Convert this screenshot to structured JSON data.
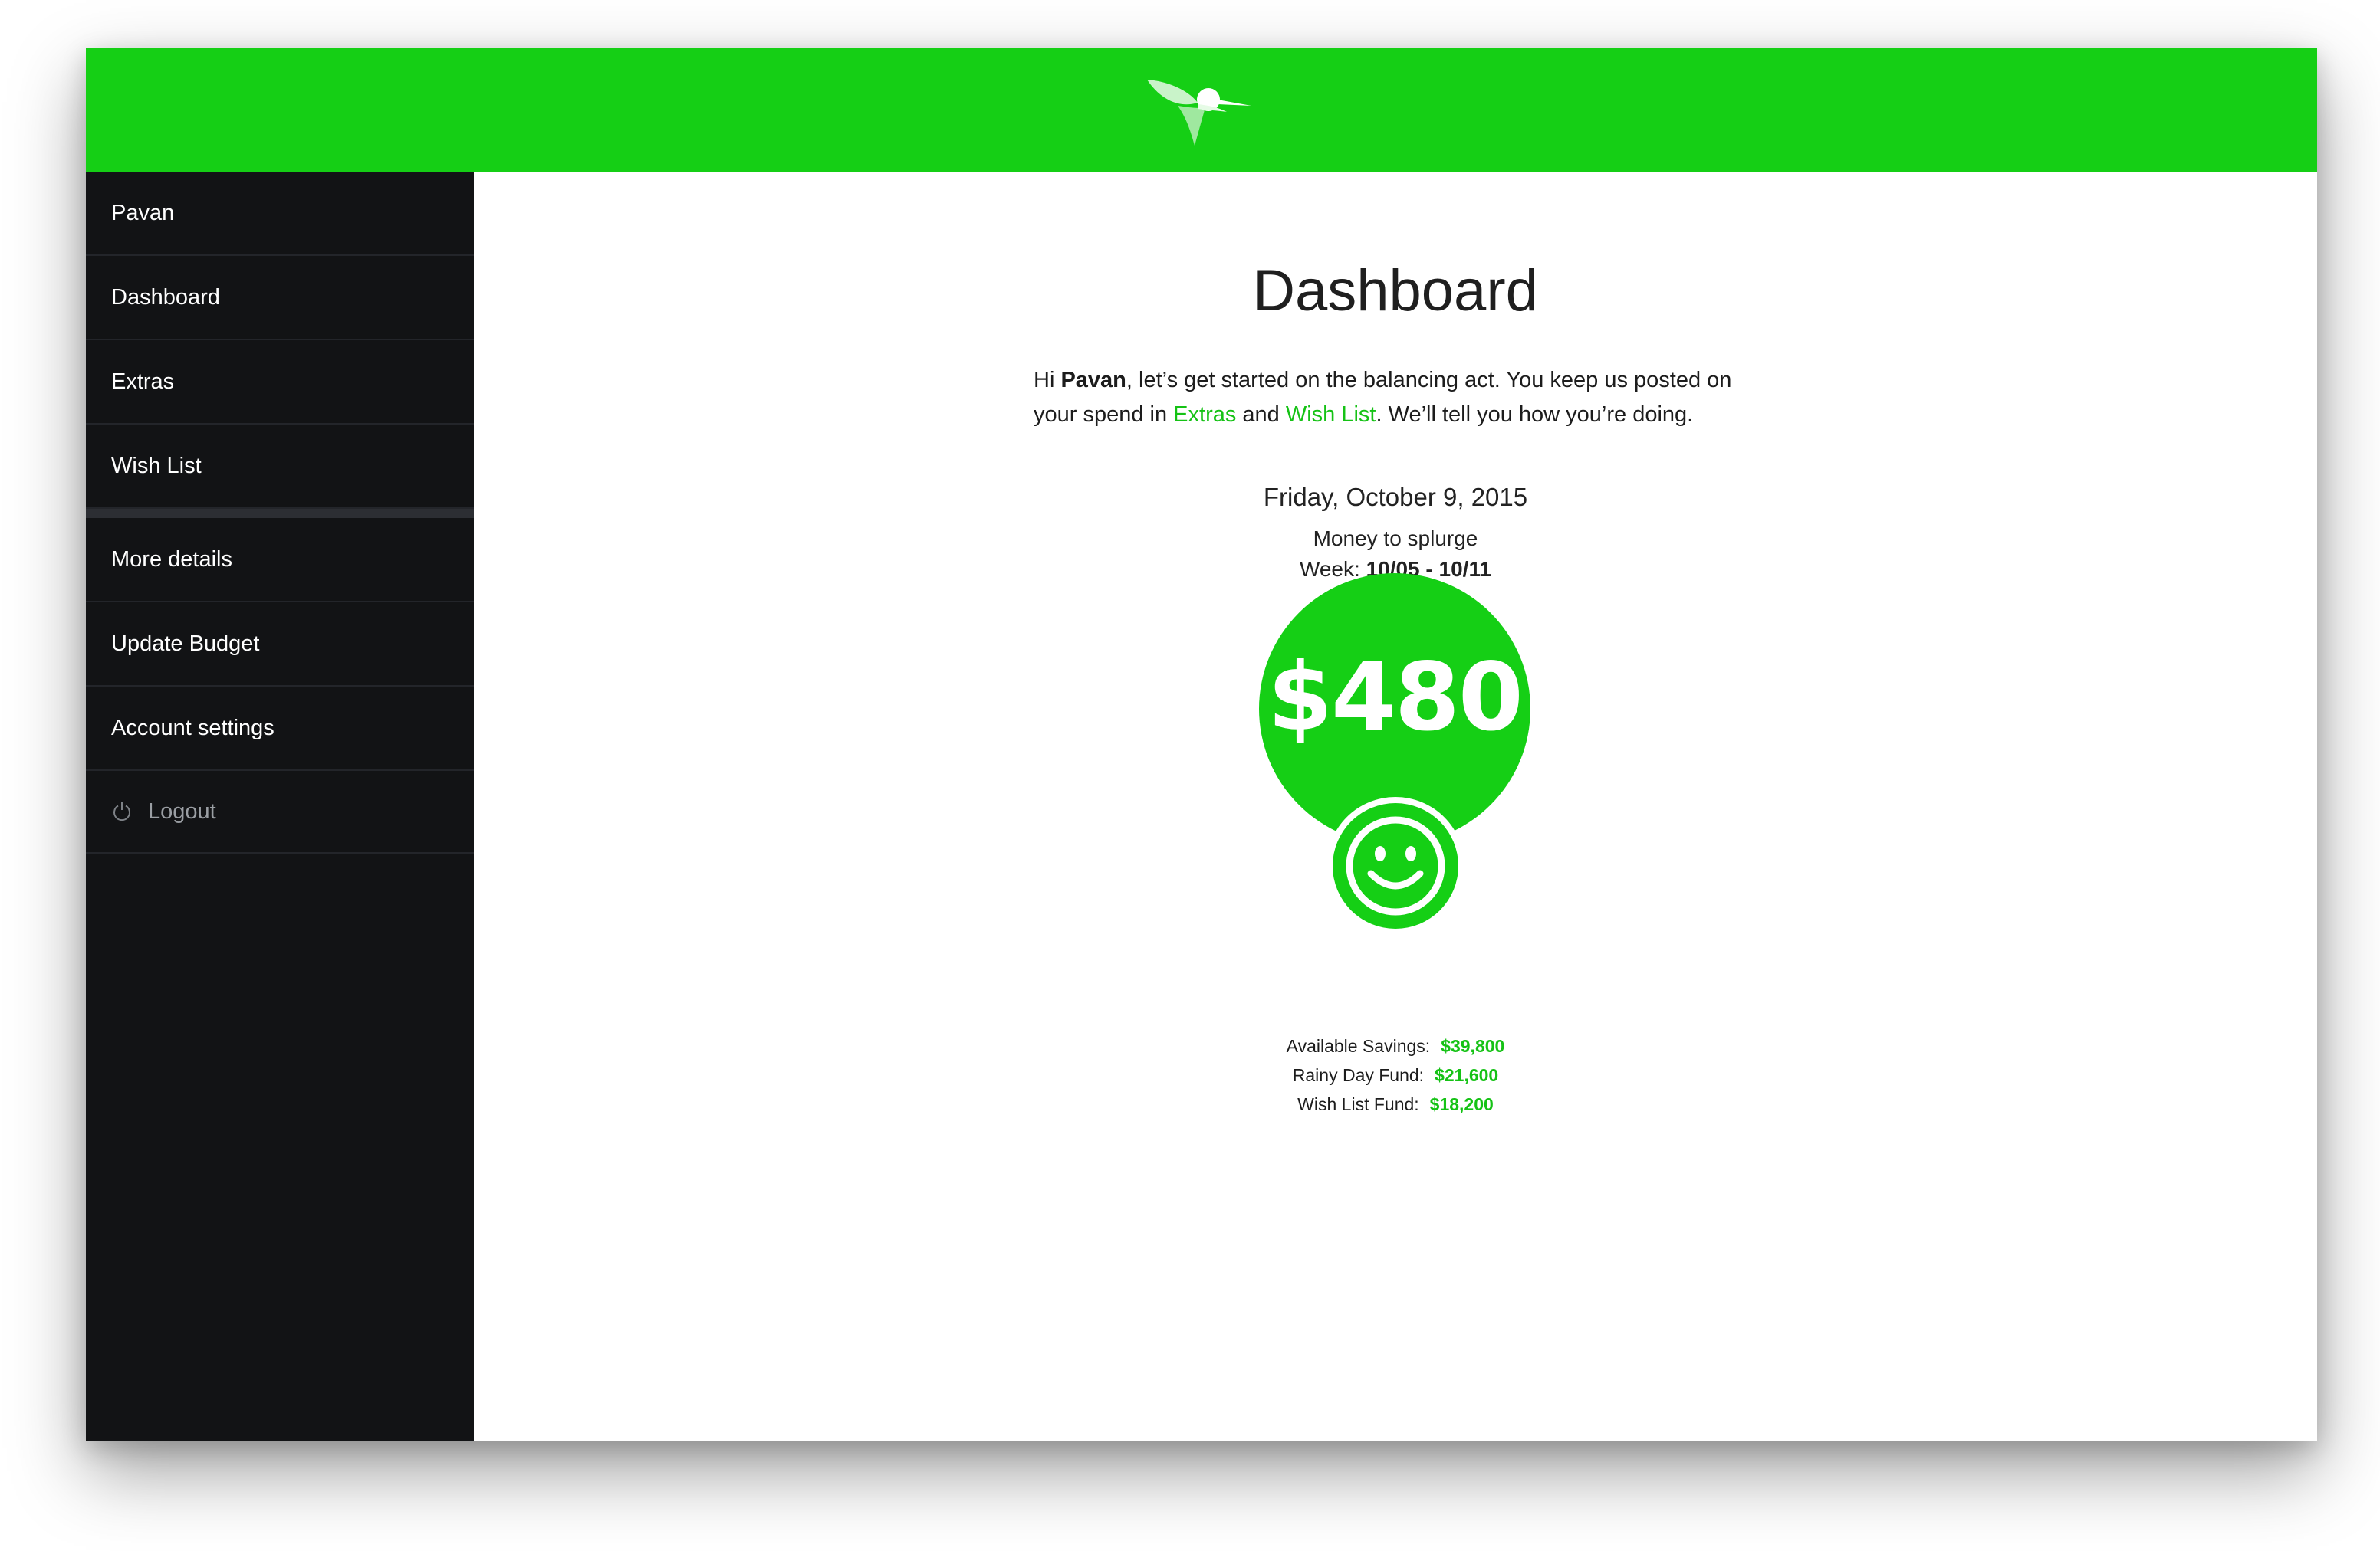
{
  "brand": {
    "accent_color": "#15cf15",
    "logo_icon": "hummingbird-logo-icon"
  },
  "sidebar": {
    "items": [
      {
        "label": "Pavan"
      },
      {
        "label": "Dashboard"
      },
      {
        "label": "Extras"
      },
      {
        "label": "Wish List"
      },
      {
        "label": "More details"
      },
      {
        "label": "Update Budget"
      },
      {
        "label": "Account settings"
      },
      {
        "label": "Logout",
        "icon": "power-icon"
      }
    ]
  },
  "main": {
    "title": "Dashboard",
    "intro": {
      "greeting": "Hi ",
      "user_name": "Pavan",
      "text_1": ", let’s get started on the balancing act. You keep us posted on your spend in ",
      "link_extras": "Extras",
      "text_2": " and ",
      "link_wishlist": "Wish List",
      "text_3": ". We’ll tell you how you’re doing."
    },
    "date": "Friday, October 9, 2015",
    "splurge_label": "Money to splurge",
    "week_label": "Week: ",
    "week_range": "10/05 - 10/11",
    "splurge_amount": "$480",
    "mood_icon": "smiley-icon",
    "funds": [
      {
        "label": "Available Savings:",
        "value": "$39,800"
      },
      {
        "label": "Rainy Day Fund:",
        "value": "$21,600"
      },
      {
        "label": "Wish List Fund:",
        "value": "$18,200"
      }
    ]
  }
}
